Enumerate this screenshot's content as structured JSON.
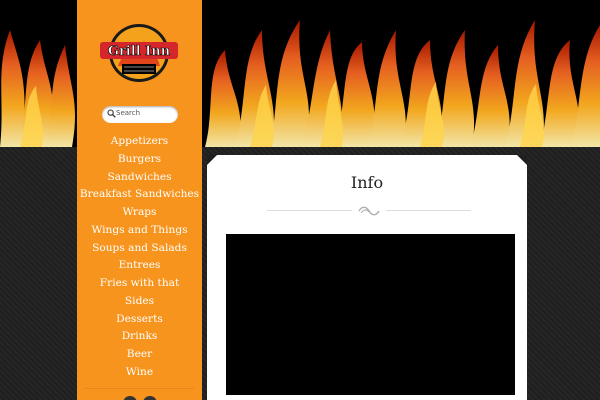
{
  "brand": {
    "logo_text": "Grill Inn"
  },
  "search": {
    "placeholder": "Search"
  },
  "menu": {
    "items": [
      "Appetizers",
      "Burgers",
      "Sandwiches",
      "Breakfast Sandwiches",
      "Wraps",
      "Wings and Things",
      "Soups and Salads",
      "Entrees",
      "Fries with that",
      "Sides",
      "Desserts",
      "Drinks",
      "Beer",
      "Wine"
    ]
  },
  "page": {
    "title": "Info"
  },
  "colors": {
    "sidebar": "#f7941d",
    "logo_red": "#d4262b",
    "flame": "#f26522",
    "card": "#ffffff"
  },
  "icons": {
    "search": "magnifier-icon",
    "divider": "squiggle-ornament-icon"
  }
}
